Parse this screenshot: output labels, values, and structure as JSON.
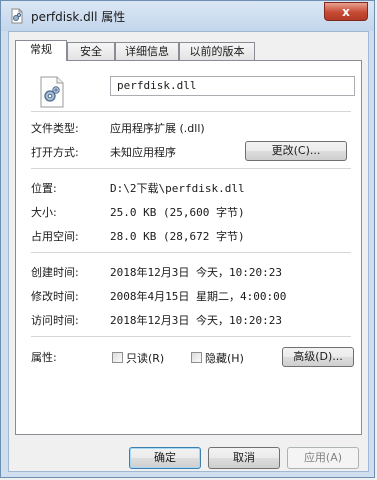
{
  "window": {
    "title": "perfdisk.dll 属性",
    "close_label": "x"
  },
  "tabs": [
    {
      "label": "常规",
      "active": true
    },
    {
      "label": "安全",
      "active": false
    },
    {
      "label": "详细信息",
      "active": false
    },
    {
      "label": "以前的版本",
      "active": false
    }
  ],
  "general": {
    "file_name": "perfdisk.dll",
    "file_type_label": "文件类型:",
    "file_type_value": "应用程序扩展 (.dll)",
    "opens_with_label": "打开方式:",
    "opens_with_value": "未知应用程序",
    "change_button": "更改(C)...",
    "location_label": "位置:",
    "location_value": "D:\\2下载\\perfdisk.dll",
    "size_label": "大小:",
    "size_value": "25.0 KB (25,600 字节)",
    "size_on_disk_label": "占用空间:",
    "size_on_disk_value": "28.0 KB (28,672 字节)",
    "created_label": "创建时间:",
    "created_value": "2018年12月3日 今天，10:20:23",
    "modified_label": "修改时间:",
    "modified_value": "2008年4月15日 星期二，4:00:00",
    "accessed_label": "访问时间:",
    "accessed_value": "2018年12月3日 今天，10:20:23",
    "attributes_label": "属性:",
    "readonly_label": "只读(R)",
    "readonly_checked": false,
    "hidden_label": "隐藏(H)",
    "hidden_checked": false,
    "advanced_button": "高级(D)..."
  },
  "footer": {
    "ok_button": "确定",
    "cancel_button": "取消",
    "apply_button": "应用(A)"
  },
  "colors": {
    "title_gradient_top": "#dbe7f5",
    "close_button": "#c74a34",
    "default_button_border": "#3c7fb1"
  },
  "icons": {
    "title": "dll-file-icon",
    "file": "dll-file-icon"
  }
}
